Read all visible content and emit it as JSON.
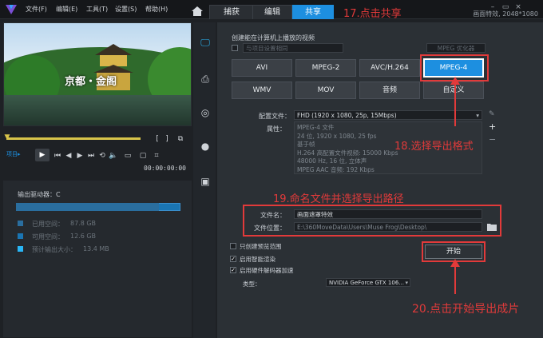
{
  "window": {
    "title": "画面特效, 2048*1080",
    "menu": [
      "文件(F)",
      "编辑(E)",
      "工具(T)",
      "设置(S)",
      "帮助(H)"
    ],
    "tabs": [
      {
        "label": "捕获"
      },
      {
        "label": "编辑"
      },
      {
        "label": "共享"
      }
    ],
    "active_tab": "共享"
  },
  "annotations": {
    "step17": "17.点击共享",
    "step18": "18.选择导出格式",
    "step19": "19.命名文件并选择导出路径",
    "step20": "20.点击开始导出成片"
  },
  "preview": {
    "caption": "京都・金阁",
    "project_label": "项目▸",
    "timecode": "00:00:00:00"
  },
  "drive": {
    "label": "输出驱动器：C",
    "fill_fraction": 0.87,
    "used_label": "已用空间：",
    "used_value": "87.8 GB",
    "free_label": "可用空间：",
    "free_value": "12.6 GB",
    "estimate_label": "预计输出大小：",
    "estimate_value": "13.4 MB",
    "colors": {
      "used": "#2a6e9f",
      "free": "#1a75b3",
      "estimate": "#29b6f6"
    }
  },
  "share": {
    "heading": "创建能在计算机上播放的视频",
    "use_preset_label": "与项目设置相同",
    "smart_label": "MPEG 优化器",
    "formats_row1": [
      "AVI",
      "MPEG-2",
      "AVC/H.264",
      "MPEG-4"
    ],
    "formats_row2": [
      "WMV",
      "MOV",
      "音频",
      "自定义"
    ],
    "selected_format": "MPEG-4",
    "profile_label": "配置文件：",
    "profile_value": "FHD (1920 x 1080, 25p, 15Mbps)",
    "attributes_label": "属性：",
    "attributes": [
      "MPEG-4 文件",
      "24 位, 1920 x 1080, 25 fps",
      "基于帧",
      "H.264 高配置文件视频: 15000 Kbps",
      "48000 Hz, 16 位, 立体声",
      "MPEG AAC 音频: 192 Kbps"
    ],
    "filename_label": "文件名：",
    "filename_value": "画面遮罩特效",
    "location_label": "文件位置：",
    "location_value": "E:\\360MoveData\\Users\\Muse Frog\\Desktop\\",
    "options": [
      {
        "label": "只创建预览范围",
        "checked": false
      },
      {
        "label": "启用智能渲染",
        "checked": true
      },
      {
        "label": "启用硬件解码器加速",
        "checked": true
      }
    ],
    "type_label": "类型：",
    "type_value": "NVIDIA GeForce GTX 106...",
    "start_label": "开始"
  }
}
